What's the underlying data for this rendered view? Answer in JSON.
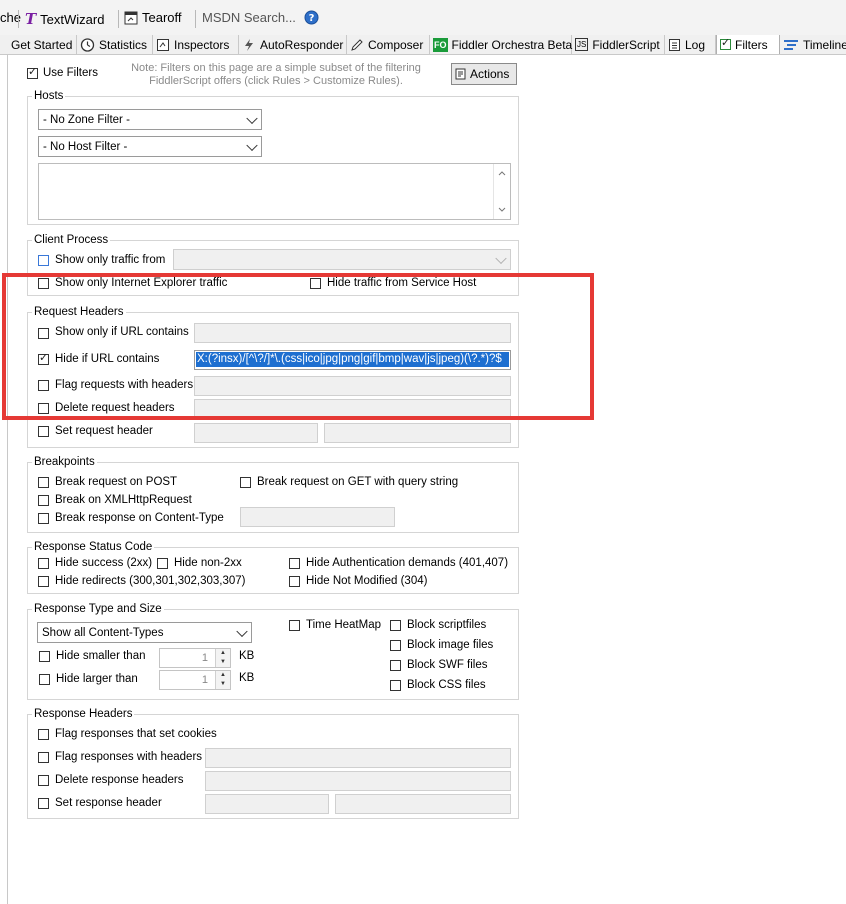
{
  "toolbar": {
    "cache_label": "che",
    "textwizard_label": "TextWizard",
    "tearoff_label": "Tearoff",
    "msdn_search_placeholder": "MSDN Search..."
  },
  "tabs": [
    {
      "label": "Get Started",
      "icon": "none"
    },
    {
      "label": "Statistics",
      "icon": "timer-icon"
    },
    {
      "label": "Inspectors",
      "icon": "inspectors-icon"
    },
    {
      "label": "AutoResponder",
      "icon": "lightning-icon"
    },
    {
      "label": "Composer",
      "icon": "pencil-icon"
    },
    {
      "label": "Fiddler Orchestra Beta",
      "icon": "fo-icon",
      "icon_text": "FO"
    },
    {
      "label": "FiddlerScript",
      "icon": "js-icon",
      "icon_text": "JS"
    },
    {
      "label": "Log",
      "icon": "log-icon"
    },
    {
      "label": "Filters",
      "icon": "checkbox-icon",
      "active": true
    },
    {
      "label": "Timeline",
      "icon": "timeline-icon"
    }
  ],
  "filters": {
    "use_filters": {
      "label": "Use Filters",
      "checked": true
    },
    "note": "Note: Filters on this page are a simple subset of the filtering FiddlerScript offers (click Rules > Customize Rules).",
    "actions_label": "Actions",
    "hosts": {
      "title": "Hosts",
      "zone_filter": "- No Zone Filter -",
      "host_filter": "- No Host Filter -"
    },
    "client_process": {
      "title": "Client Process",
      "show_only_traffic_from": "Show only traffic from",
      "show_only_ie": "Show only Internet Explorer traffic",
      "hide_service_host": "Hide traffic from Service Host"
    },
    "request_headers": {
      "title": "Request Headers",
      "show_only_url": "Show only if URL contains",
      "hide_url": "Hide if URL contains",
      "hide_url_checked": true,
      "hide_url_value": "X:(?insx)/[^\\?/]*\\.(css|ico|jpg|png|gif|bmp|wav|js|jpeg)(\\?.*)?$",
      "flag_requests": "Flag requests with headers",
      "delete_request_headers": "Delete request headers",
      "set_request_header": "Set request header"
    },
    "breakpoints": {
      "title": "Breakpoints",
      "break_post": "Break request on POST",
      "break_get": "Break request on GET with query string",
      "break_xhr": "Break on XMLHttpRequest",
      "break_content_type": "Break response on Content-Type"
    },
    "status_code": {
      "title": "Response Status Code",
      "hide_success": "Hide success (2xx)",
      "hide_non2xx": "Hide non-2xx",
      "hide_auth": "Hide Authentication demands (401,407)",
      "hide_redirects": "Hide redirects (300,301,302,303,307)",
      "hide_not_modified": "Hide Not Modified (304)"
    },
    "type_size": {
      "title": "Response Type and Size",
      "content_types": "Show all Content-Types",
      "time_heatmap": "Time HeatMap",
      "block_script": "Block scriptfiles",
      "block_image": "Block image files",
      "block_swf": "Block SWF files",
      "block_css": "Block CSS files",
      "hide_smaller": "Hide smaller than",
      "hide_larger": "Hide larger than",
      "smaller_value": "1",
      "larger_value": "1",
      "unit": "KB"
    },
    "response_headers": {
      "title": "Response Headers",
      "flag_cookies": "Flag responses that set cookies",
      "flag_headers": "Flag responses with headers",
      "delete_headers": "Delete response headers",
      "set_header": "Set response header"
    }
  },
  "colors": {
    "highlight_box": "#e53935",
    "selection": "#1e6fd0"
  }
}
